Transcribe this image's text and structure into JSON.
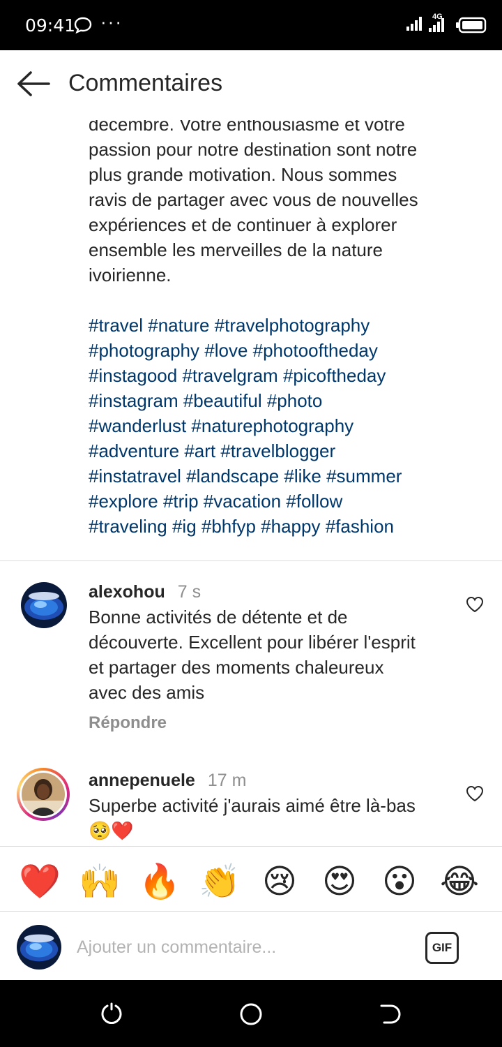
{
  "status_bar": {
    "time": "09:41",
    "dots": "···",
    "network": "4G"
  },
  "header": {
    "title": "Commentaires"
  },
  "caption": {
    "text": "décembre. Votre enthousiasme et votre\npassion pour notre destination sont notre\nplus grande motivation. Nous sommes\nravis de partager avec vous de nouvelles\nexpériences et de continuer à explorer\nensemble les merveilles de la nature\nivoirienne.",
    "hashtags": "#travel #nature #travelphotography\n#photography #love #photooftheday\n#instagood #travelgram #picoftheday\n#instagram #beautiful #photo\n#wanderlust #naturephotography\n#adventure #art #travelblogger\n#instatravel #landscape #like #summer\n#explore #trip #vacation #follow\n#traveling #ig #bhfyp #happy #fashion"
  },
  "comments": [
    {
      "username": "alexohou",
      "time": "7 s",
      "text": "Bonne activités de détente et de\ndécouverte. Excellent pour libérer l'esprit\net partager des moments chaleureux\navec des amis",
      "reply_label": "Répondre"
    },
    {
      "username": "annepenuele",
      "time": "17 m",
      "text": "Superbe activité j'aurais aimé être là-bas\n🥺❤️"
    }
  ],
  "emoji_bar": [
    "❤️",
    "🙌",
    "🔥",
    "👏",
    "😢",
    "😍",
    "😮",
    "😂"
  ],
  "composer": {
    "placeholder": "Ajouter un commentaire...",
    "gif_label": "GIF"
  },
  "colors": {
    "hashtag": "#00376b",
    "text": "#262626",
    "muted": "#8e8e8e",
    "divider": "#dbdbdb"
  }
}
